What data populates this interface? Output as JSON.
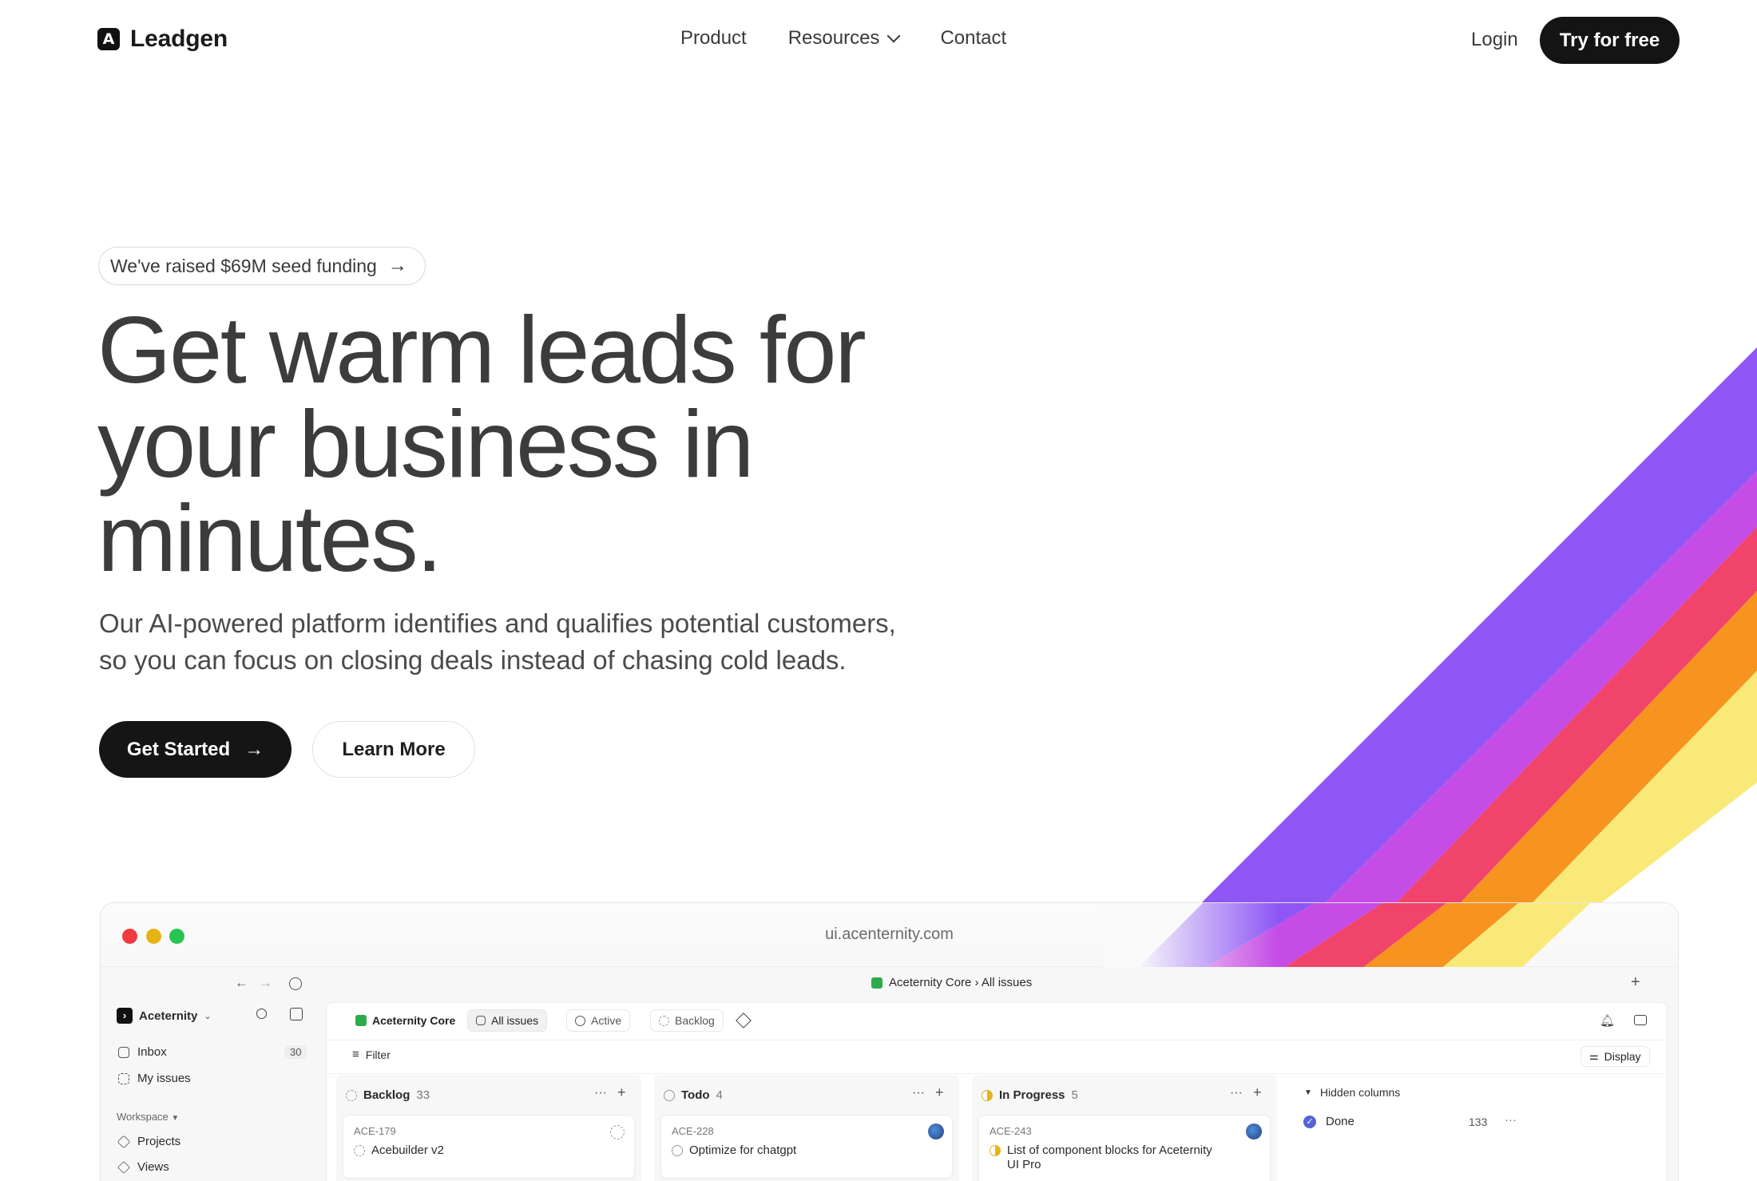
{
  "nav": {
    "brand": "Leadgen",
    "brand_mark": "A",
    "links": [
      "Product",
      "Resources",
      "Contact"
    ],
    "login": "Login",
    "cta": "Try for free"
  },
  "hero": {
    "badge": "We've raised $69M seed funding",
    "headline_line1": "Get warm leads for",
    "headline_line2": "your business in",
    "headline_line3": "minutes.",
    "subtext_line1": "Our AI-powered platform identifies and qualifies potential customers,",
    "subtext_line2": "so you can focus on closing deals instead of chasing cold leads.",
    "primary_cta": "Get Started",
    "secondary_cta": "Learn More"
  },
  "colors": {
    "rainbow": [
      "#8e56f5",
      "#c54ce5",
      "#f0446a",
      "#f7931f",
      "#f9e978"
    ],
    "traffic_lights": [
      "#f13a3f",
      "#e7b313",
      "#27c452"
    ]
  },
  "browser": {
    "url": "ui.acenternity.com",
    "breadcrumb": "Aceternity Core › All issues",
    "workspace_name": "Aceternity",
    "sidebar": {
      "inbox": "Inbox",
      "inbox_count": "30",
      "my_issues": "My issues",
      "workspace_label": "Workspace",
      "projects": "Projects",
      "views": "Views"
    },
    "toolbar": {
      "project": "Aceternity Core",
      "all_issues": "All issues",
      "active": "Active",
      "backlog": "Backlog",
      "filter": "Filter",
      "display": "Display"
    },
    "columns": [
      {
        "name": "Backlog",
        "count": "33",
        "card_id": "ACE-179",
        "card_title": "Acebuilder v2"
      },
      {
        "name": "Todo",
        "count": "4",
        "card_id": "ACE-228",
        "card_title": "Optimize for chatgpt"
      },
      {
        "name": "In Progress",
        "count": "5",
        "card_id": "ACE-243",
        "card_title": "List of component blocks for Aceternity",
        "card_title_2": "UI Pro"
      }
    ],
    "hidden": {
      "label": "Hidden columns",
      "done": "Done",
      "done_count": "133"
    }
  }
}
